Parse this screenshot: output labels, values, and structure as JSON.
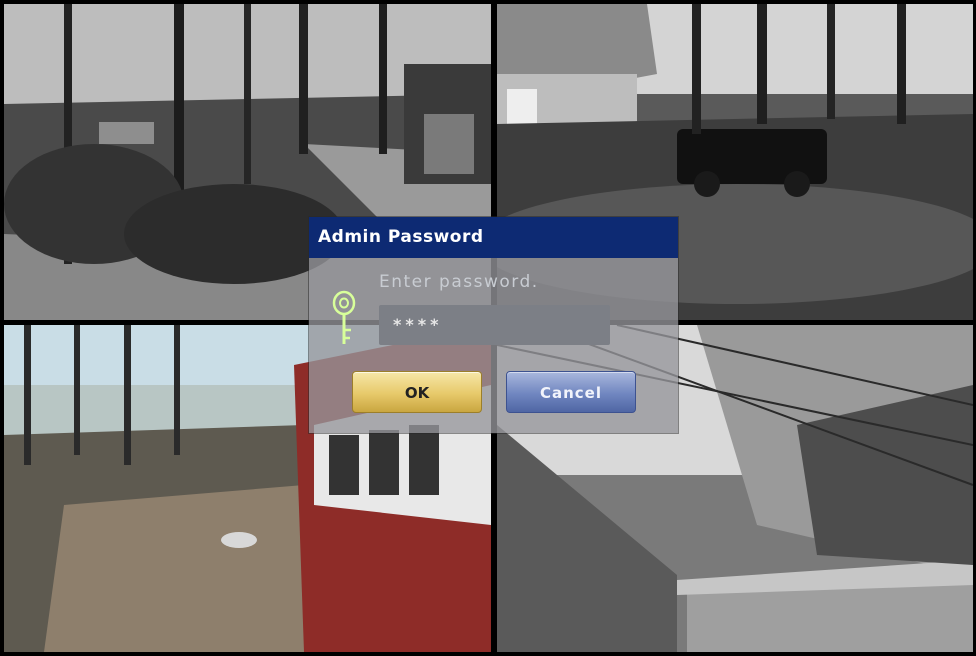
{
  "dialog": {
    "title": "Admin Password",
    "prompt": "Enter password.",
    "password_value": "****",
    "ok_label": "OK",
    "cancel_label": "Cancel",
    "icon": "key-icon"
  },
  "colors": {
    "title_bar": "#0d2a73",
    "ok_button": "#e7c96a",
    "cancel_button": "#7086c0"
  }
}
